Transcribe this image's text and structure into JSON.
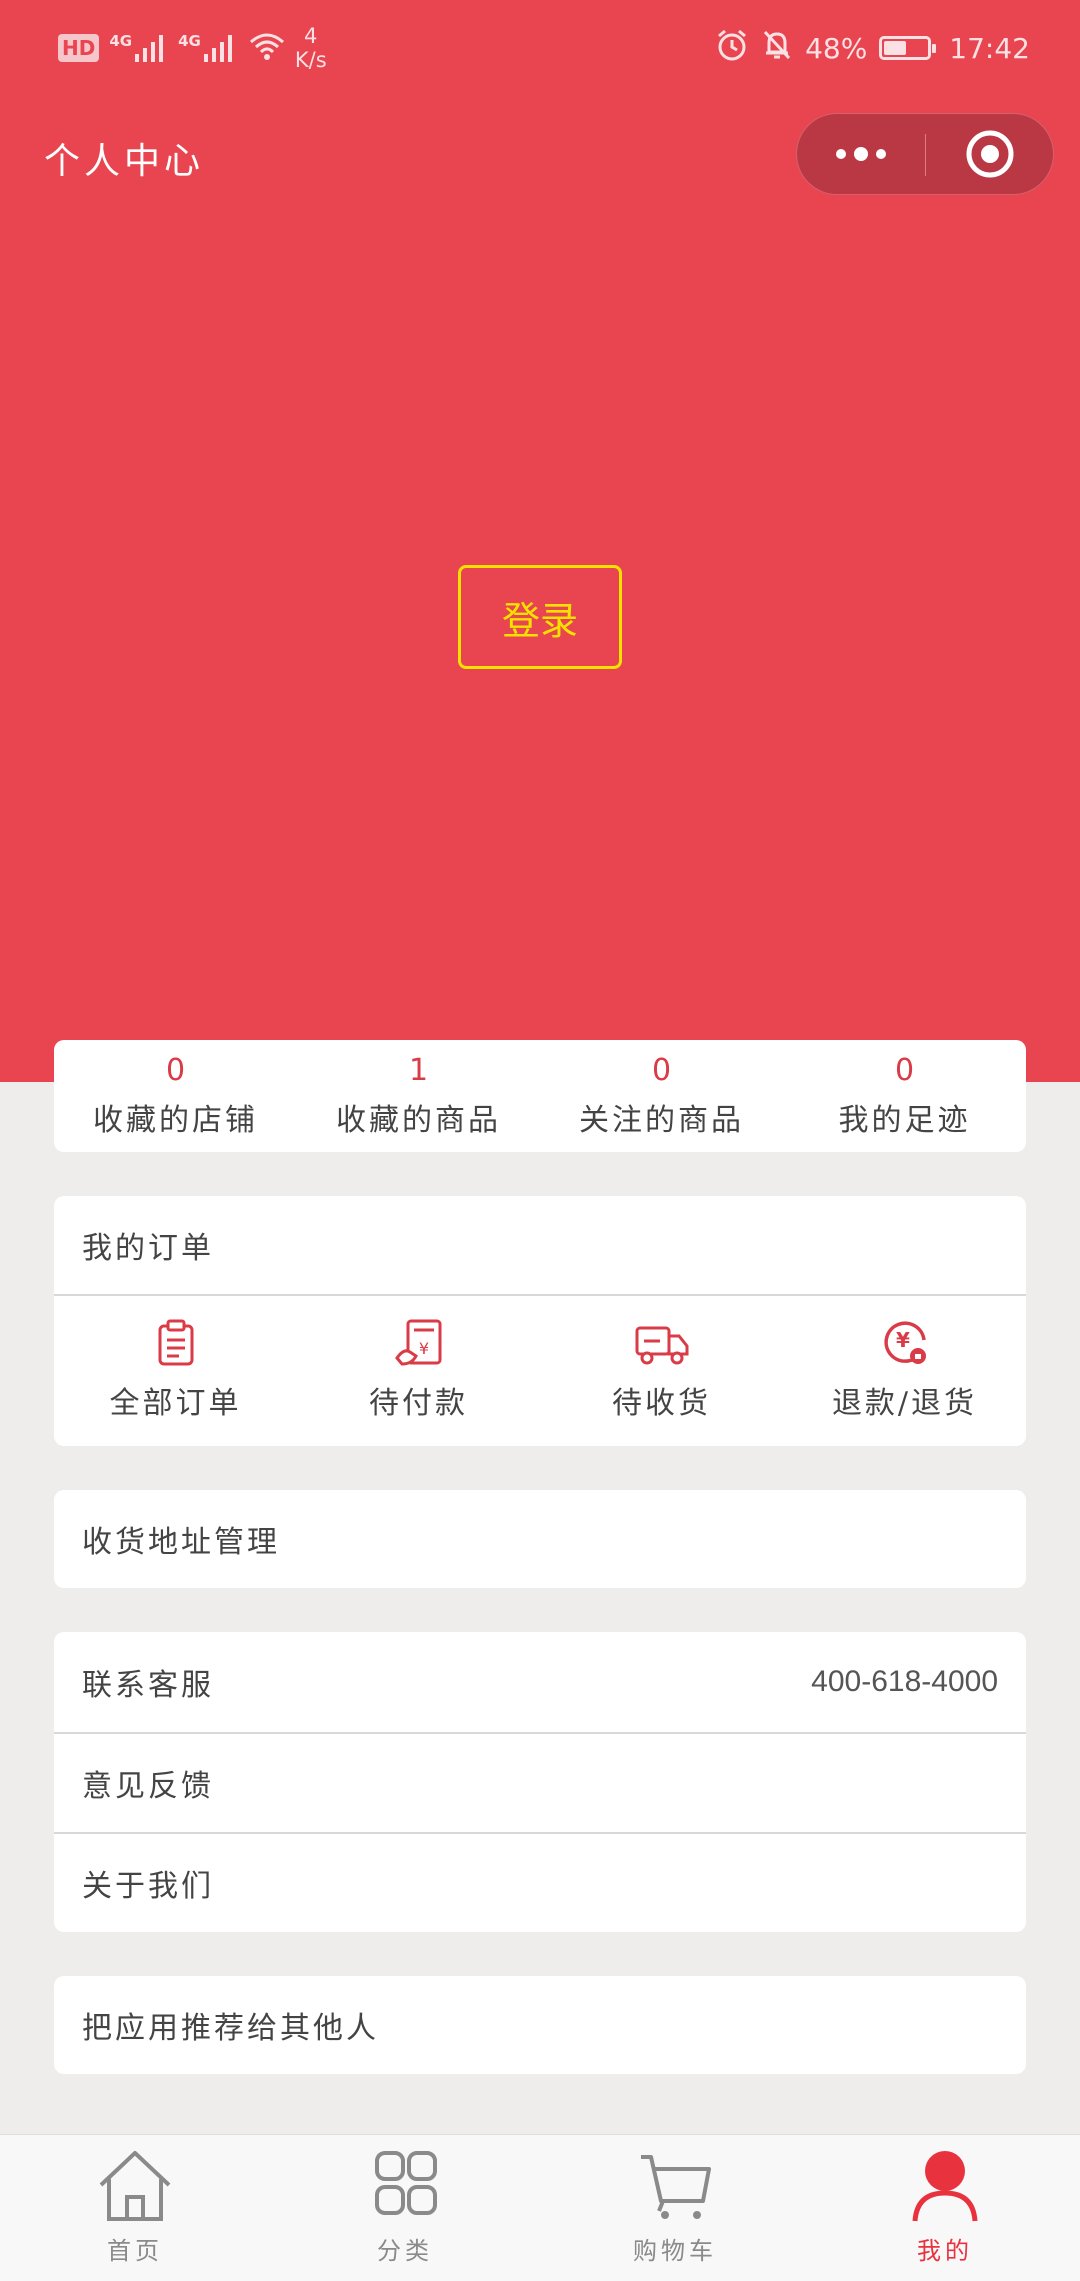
{
  "status_bar": {
    "hd": "HD",
    "net1": "4G",
    "net2": "4G",
    "speed_value": "4",
    "speed_unit": "K/s",
    "battery": "48%",
    "battery_level": 0.48,
    "time": "17:42"
  },
  "header": {
    "title": "个人中心"
  },
  "login": {
    "label": "登录"
  },
  "stats": [
    {
      "count": "0",
      "label": "收藏的店铺"
    },
    {
      "count": "1",
      "label": "收藏的商品"
    },
    {
      "count": "0",
      "label": "关注的商品"
    },
    {
      "count": "0",
      "label": "我的足迹"
    }
  ],
  "orders": {
    "title": "我的订单",
    "items": [
      {
        "label": "全部订单",
        "icon": "clipboard-icon"
      },
      {
        "label": "待付款",
        "icon": "payment-icon"
      },
      {
        "label": "待收货",
        "icon": "truck-icon"
      },
      {
        "label": "退款/退货",
        "icon": "refund-icon"
      }
    ]
  },
  "address": {
    "label": "收货地址管理"
  },
  "service": {
    "contact_label": "联系客服",
    "contact_phone": "400-618-4000",
    "feedback_label": "意见反馈",
    "about_label": "关于我们"
  },
  "recommend": {
    "label": "把应用推荐给其他人"
  },
  "tabbar": [
    {
      "label": "首页",
      "icon": "home-icon",
      "active": false
    },
    {
      "label": "分类",
      "icon": "category-icon",
      "active": false
    },
    {
      "label": "购物车",
      "icon": "cart-icon",
      "active": false
    },
    {
      "label": "我的",
      "icon": "user-icon",
      "active": true
    }
  ],
  "colors": {
    "brand_red": "#e84550",
    "accent_yellow": "#f5e100",
    "active_tab": "#e8333f",
    "background": "#eeedeb"
  }
}
